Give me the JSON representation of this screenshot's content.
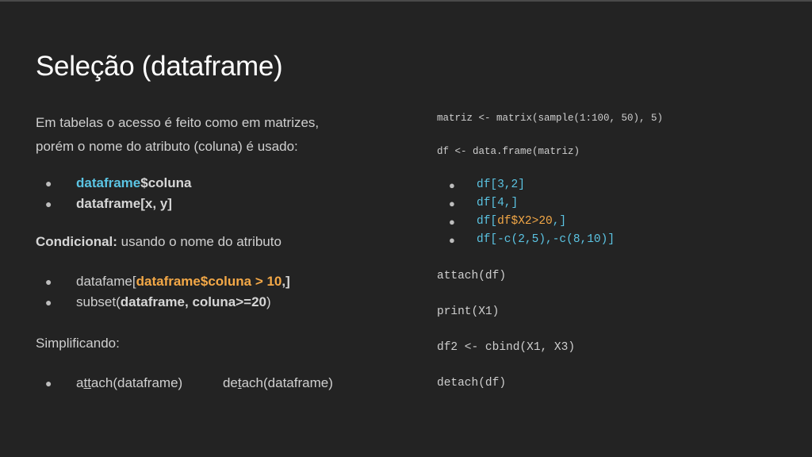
{
  "title": "Seleção (dataframe)",
  "left": {
    "intro_line1": "Em tabelas o acesso é feito como em matrizes,",
    "intro_line2": "porém o nome do atributo (coluna) é usado:",
    "b1_part1": "dataframe",
    "b1_part2": "$coluna",
    "b2": "dataframe[x, y]",
    "cond_label": "Condicional:",
    "cond_text": " usando o nome do atributo",
    "c1_pre": "datafame[",
    "c1_highlight": "dataframe$coluna > 10",
    "c1_post": ",]",
    "c2_pre": "subset(",
    "c2_bold": "dataframe, coluna>=20",
    "c2_post": ")",
    "simp": "Simplificando:",
    "attach_a": "a",
    "attach_tt": "tt",
    "attach_rest": "ach(dataframe)",
    "detach_de": "de",
    "detach_t": "t",
    "detach_rest": "ach(dataframe)",
    "bullet": "●"
  },
  "code": {
    "line1": "matriz <- matrix(sample(1:100, 50), 5)",
    "line2": "df <- data.frame(matriz)",
    "b1": "df[3,2]",
    "b2": "df[4,]",
    "b3_pre": "df[",
    "b3_mid": "df$X2>20",
    "b3_post": ",]",
    "b4": "df[-c(2,5),-c(8,10)]",
    "l3": "attach(df)",
    "l4": "print(X1)",
    "l5": "df2 <- cbind(X1, X3)",
    "l6": "detach(df)"
  },
  "colors": {
    "background": "#232323",
    "cyan": "#5bc4e3",
    "orange": "#f3a847",
    "text": "#cfcfcf"
  }
}
